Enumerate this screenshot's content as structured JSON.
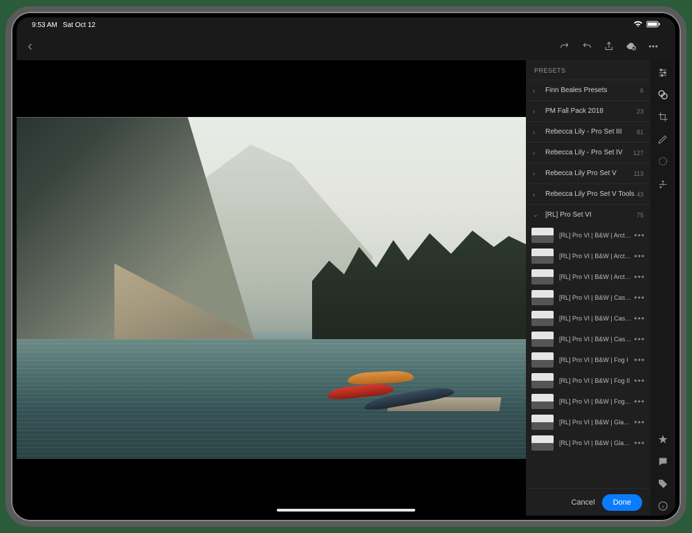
{
  "status": {
    "time": "9:53 AM",
    "date": "Sat Oct 12"
  },
  "panel_title": "PRESETS",
  "groups": [
    {
      "name": "Finn Beales Presets",
      "count": "6",
      "expanded": false
    },
    {
      "name": "PM Fall Pack 2018",
      "count": "23",
      "expanded": false
    },
    {
      "name": "Rebecca Lily - Pro Set III",
      "count": "81",
      "expanded": false
    },
    {
      "name": "Rebecca Lily - Pro Set IV",
      "count": "127",
      "expanded": false
    },
    {
      "name": "Rebecca Lily Pro Set V",
      "count": "113",
      "expanded": false
    },
    {
      "name": "Rebecca Lily Pro Set V Tools",
      "count": "43",
      "expanded": false
    },
    {
      "name": "[RL] Pro Set VI",
      "count": "75",
      "expanded": true
    }
  ],
  "presets": [
    {
      "name": "[RL] Pro VI | B&W | Arctic I"
    },
    {
      "name": "[RL] Pro VI | B&W | Arctic II"
    },
    {
      "name": "[RL] Pro VI | B&W | Arctic III"
    },
    {
      "name": "[RL] Pro VI | B&W | Casabl…"
    },
    {
      "name": "[RL] Pro VI | B&W | Casabl…"
    },
    {
      "name": "[RL] Pro VI | B&W | Casabl…"
    },
    {
      "name": "[RL] Pro VI | B&W | Fog I"
    },
    {
      "name": "[RL] Pro VI | B&W | Fog II"
    },
    {
      "name": "[RL] Pro VI | B&W | Fog III"
    },
    {
      "name": "[RL] Pro VI | B&W | Glacier I"
    },
    {
      "name": "[RL] Pro VI | B&W | Glacier II"
    }
  ],
  "buttons": {
    "cancel": "Cancel",
    "done": "Done"
  }
}
